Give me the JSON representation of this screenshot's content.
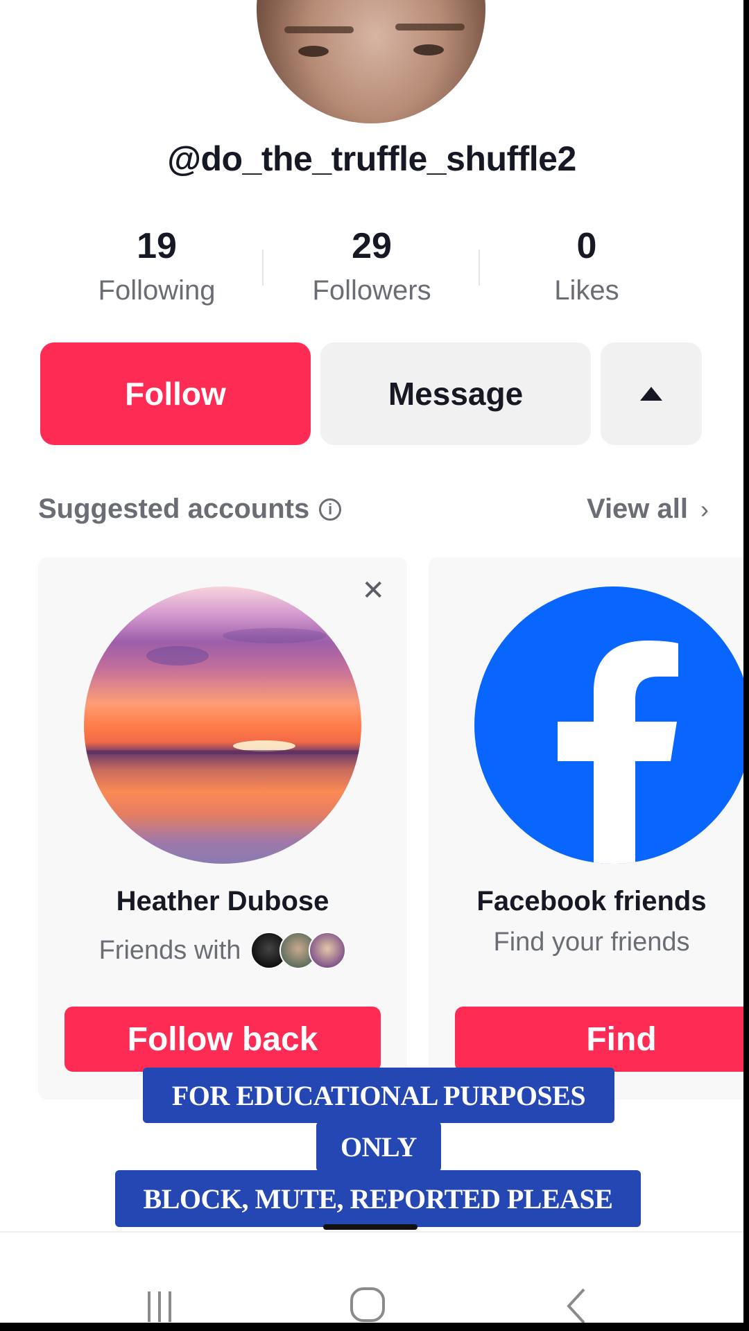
{
  "profile": {
    "username": "@do_the_truffle_shuffle2",
    "stats": [
      {
        "value": "19",
        "label": "Following"
      },
      {
        "value": "29",
        "label": "Followers"
      },
      {
        "value": "0",
        "label": "Likes"
      }
    ]
  },
  "actions": {
    "follow_label": "Follow",
    "message_label": "Message",
    "more_icon": "caret-up-icon"
  },
  "suggested": {
    "title": "Suggested accounts",
    "view_all": "View all",
    "cards": [
      {
        "name": "Heather Dubose",
        "subtitle": "Friends with",
        "button": "Follow back"
      },
      {
        "name": "Facebook friends",
        "subtitle": "Find your friends",
        "button": "Find"
      }
    ]
  },
  "overlay": {
    "line1": "FOR EDUCATIONAL PURPOSES",
    "line2": "ONLY",
    "line3": "BLOCK, MUTE, REPORTED PLEASE"
  },
  "colors": {
    "accent": "#fe2c55",
    "facebook": "#0866ff",
    "banner": "#2547b3"
  }
}
